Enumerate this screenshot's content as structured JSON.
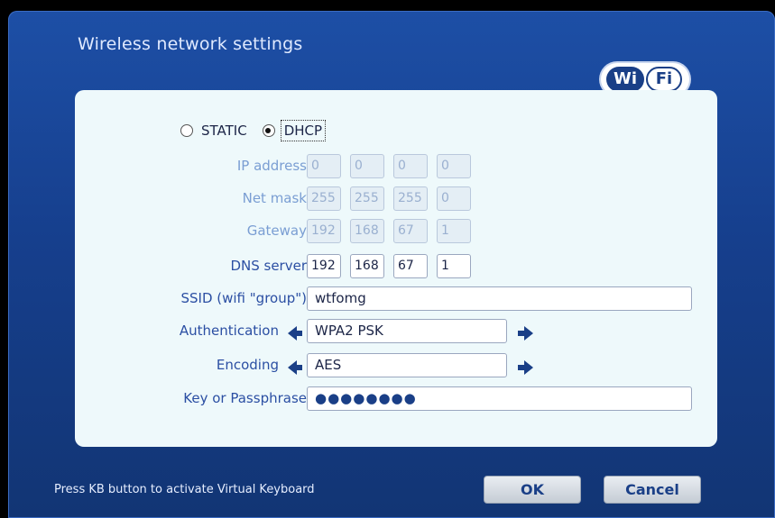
{
  "window": {
    "title": "Wireless network settings"
  },
  "logo": {
    "part1": "Wi",
    "part2": "Fi"
  },
  "mode": {
    "static_label": "STATIC",
    "dhcp_label": "DHCP",
    "selected": "DHCP"
  },
  "ip": {
    "label": "IP address",
    "octets": [
      "0",
      "0",
      "0",
      "0"
    ]
  },
  "netmask": {
    "label": "Net mask",
    "octets": [
      "255",
      "255",
      "255",
      "0"
    ]
  },
  "gateway": {
    "label": "Gateway",
    "octets": [
      "192",
      "168",
      "67",
      "1"
    ]
  },
  "dns": {
    "label": "DNS server",
    "octets": [
      "192",
      "168",
      "67",
      "1"
    ]
  },
  "ssid": {
    "label": "SSID (wifi \"group\")",
    "value": "wtfomg"
  },
  "auth": {
    "label": "Authentication",
    "value": "WPA2 PSK"
  },
  "encoding": {
    "label": "Encoding",
    "value": "AES"
  },
  "key": {
    "label": "Key or Passphrase",
    "value": "●●●●●●●●"
  },
  "footer": {
    "hint": "Press KB button to activate Virtual Keyboard",
    "ok_label": "OK",
    "cancel_label": "Cancel"
  },
  "colors": {
    "accent": "#1a3f87",
    "panel": "#eef9fb",
    "window_bg": "#1d4fa6"
  },
  "icons": {
    "prev": "arrow-left-icon",
    "next": "arrow-right-icon"
  }
}
